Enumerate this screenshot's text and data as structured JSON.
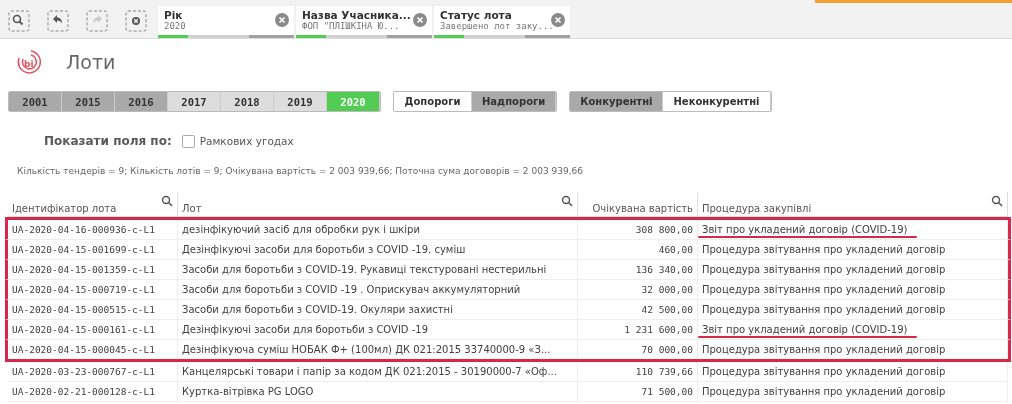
{
  "toolbar": {
    "buttons": [
      {
        "kind": "search",
        "disabled": false
      },
      {
        "kind": "back",
        "disabled": false
      },
      {
        "kind": "forward",
        "disabled": true
      },
      {
        "kind": "clear",
        "disabled": false
      }
    ]
  },
  "filters": [
    {
      "field": "Рік",
      "value": "2020"
    },
    {
      "field": "Назва Учасника...",
      "value": "ФОП \"ПЛІШКІНА Ю..."
    },
    {
      "field": "Статус лота",
      "value": "Завершено лот заку..."
    }
  ],
  "page": {
    "logo": "bi",
    "title": "Лоти"
  },
  "years": [
    {
      "label": "2001",
      "selected": false,
      "excluded": true,
      "alternative": false
    },
    {
      "label": "2015",
      "selected": false,
      "excluded": true,
      "alternative": false
    },
    {
      "label": "2016",
      "selected": false,
      "excluded": true,
      "alternative": false
    },
    {
      "label": "2017",
      "selected": false,
      "excluded": false,
      "alternative": true
    },
    {
      "label": "2018",
      "selected": false,
      "excluded": false,
      "alternative": true
    },
    {
      "label": "2019",
      "selected": false,
      "excluded": false,
      "alternative": true
    },
    {
      "label": "2020",
      "selected": true,
      "excluded": false,
      "alternative": false
    }
  ],
  "thresholds": [
    {
      "label": "Допороги",
      "selected": false,
      "excluded": false
    },
    {
      "label": "Надпороги",
      "selected": false,
      "excluded": true
    }
  ],
  "competition": [
    {
      "label": "Конкурентні",
      "selected": false,
      "excluded": true
    },
    {
      "label": "Неконкурентні",
      "selected": false,
      "excluded": false
    }
  ],
  "show_fields": {
    "label": "Показати поля по:",
    "option": "Рамкових угодах",
    "checked": false
  },
  "summary": "Кількість тендерів = 9; Кількість лотів = 9; Очікувана вартість = 2 003 939,66; Поточна сума договорів = 2 003 939,66",
  "table": {
    "columns": [
      "Ідентифікатор лота",
      "Лот",
      "Очікувана вартість",
      "Процедура закупівлі"
    ],
    "rows": [
      {
        "cells": [
          "UA-2020-04-16-000936-c-L1",
          "дезінфікуючий засіб для обробки рук і шкіри",
          "308 800,00",
          "Звіт про укладений договір (COVID-19)"
        ],
        "boxed": true,
        "underlined": true
      },
      {
        "cells": [
          "UA-2020-04-15-001699-c-L1",
          "Дезінфікуючі засоби для боротьби з COVID -19. суміш",
          "460,00",
          "Процедура звітування про укладений договір"
        ],
        "boxed": true,
        "underlined": false
      },
      {
        "cells": [
          "UA-2020-04-15-001359-c-L1",
          "Засоби для боротьби з COVID-19. Рукавиці текстуровані нестерильні",
          "136 340,00",
          "Процедура звітування про укладений договір"
        ],
        "boxed": true,
        "underlined": false
      },
      {
        "cells": [
          "UA-2020-04-15-000719-c-L1",
          "Засоби для боротьби з COVID -19 . Оприскувач аккумуляторний",
          "32 000,00",
          "Процедура звітування про укладений договір"
        ],
        "boxed": true,
        "underlined": false
      },
      {
        "cells": [
          "UA-2020-04-15-000515-c-L1",
          "Засоби для боротьби з COVID-19. Окуляри захистні",
          "42 500,00",
          "Процедура звітування про укладений договір"
        ],
        "boxed": true,
        "underlined": false
      },
      {
        "cells": [
          "UA-2020-04-15-000161-c-L1",
          "Дезінфікуючі засоби для боротьби з COVID -19",
          "1 231 600,00",
          "Звіт про укладений договір (COVID-19)"
        ],
        "boxed": true,
        "underlined": true
      },
      {
        "cells": [
          "UA-2020-04-15-000045-c-L1",
          "Дезінфікуюча суміш НОБАК Ф+ (100мл) ДК 021:2015 33740000-9 «З...",
          "70 000,00",
          "Процедура звітування про укладений договір"
        ],
        "boxed": true,
        "underlined": false
      },
      {
        "cells": [
          "UA-2020-03-23-000767-c-L1",
          "Канцелярські товари і папір за кодом ДК 021:2015 - 30190000-7 «Оф...",
          "110 739,66",
          "Процедура звітування про укладений договір"
        ],
        "boxed": false,
        "underlined": false
      },
      {
        "cells": [
          "UA-2020-02-21-000128-c-L1",
          "Куртка-вітрівка PG LOGO",
          "71 500,00",
          "Процедура звітування про укладений договір"
        ],
        "boxed": false,
        "underlined": false
      }
    ]
  }
}
